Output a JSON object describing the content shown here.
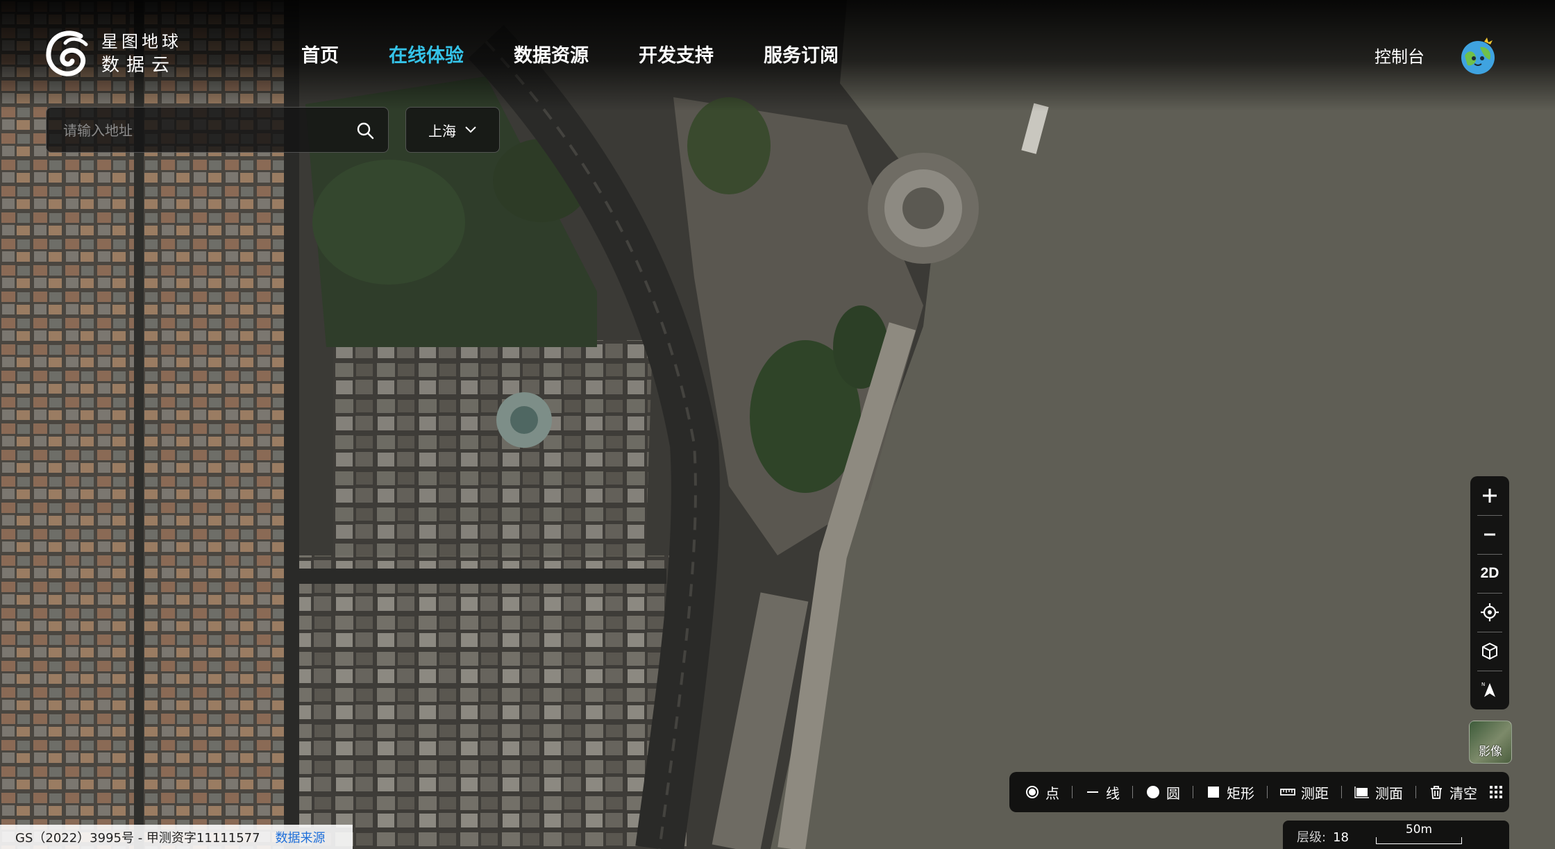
{
  "brand": {
    "line1": "星图地球",
    "line2": "数据云"
  },
  "nav": [
    {
      "label": "首页",
      "active": false
    },
    {
      "label": "在线体验",
      "active": true
    },
    {
      "label": "数据资源",
      "active": false
    },
    {
      "label": "开发支持",
      "active": false
    },
    {
      "label": "服务订阅",
      "active": false
    }
  ],
  "console_label": "控制台",
  "search": {
    "placeholder": "请输入地址",
    "value": ""
  },
  "city_selector": {
    "value": "上海",
    "icon": "chevron-down-icon"
  },
  "map_controls": {
    "zoom_in_icon": "plus-icon",
    "zoom_out_icon": "minus-icon",
    "mode_label": "2D",
    "locate_icon": "target-icon",
    "view_3d_icon": "cube-icon",
    "compass_icon": "north-arrow-icon",
    "imagery_label": "影像"
  },
  "draw_tools": [
    {
      "label": "点",
      "icon": "point-icon"
    },
    {
      "label": "线",
      "icon": "line-icon"
    },
    {
      "label": "圆",
      "icon": "circle-icon"
    },
    {
      "label": "矩形",
      "icon": "rectangle-icon"
    },
    {
      "label": "测距",
      "icon": "ruler-icon"
    },
    {
      "label": "测面",
      "icon": "area-icon"
    },
    {
      "label": "清空",
      "icon": "trash-icon"
    }
  ],
  "more_icon": "grid-icon",
  "status": {
    "level_label": "层级:",
    "level_value": "18",
    "scale_label": "50m"
  },
  "copyright": {
    "text": "GS（2022）3995号 - 甲测资字11111577",
    "source_link": "数据来源"
  },
  "colors": {
    "accent": "#35c3e8",
    "river": "#5f5e55",
    "toolbar_bg": "#0a0a0a",
    "link": "#1e6fd9"
  }
}
